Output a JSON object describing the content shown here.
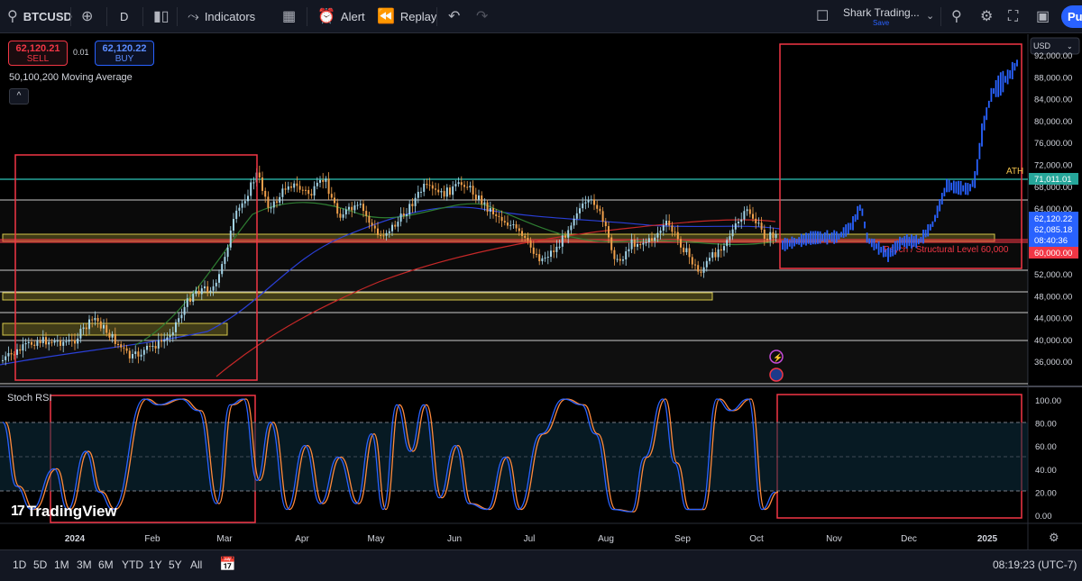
{
  "toolbar": {
    "symbol": "BTCUSD",
    "interval": "D",
    "indicators_label": "Indicators",
    "alert_label": "Alert",
    "replay_label": "Replay",
    "layout_name": "Shark Trading...",
    "save_label": "Save",
    "publish_label": "Pu",
    "icons": [
      "search-icon",
      "add-symbol-icon",
      "candles-icon",
      "indicators-icon",
      "templates-icon",
      "alert-icon",
      "replay-icon",
      "undo-icon",
      "redo-icon",
      "layout-icon",
      "chevron-down-icon",
      "quick-search-icon",
      "settings-icon",
      "fullscreen-icon",
      "camera-icon"
    ]
  },
  "trade": {
    "sell_price": "62,120.21",
    "sell_label": "SELL",
    "spread": "0.01",
    "buy_price": "62,120.22",
    "buy_label": "BUY"
  },
  "legend": {
    "moving_average": "50,100,200 Moving Average",
    "collapse_icon": "^"
  },
  "price_axis": {
    "currency": "USD",
    "ticks": [
      "92,000.00",
      "88,000.00",
      "84,000.00",
      "80,000.00",
      "76,000.00",
      "72,000.00",
      "68,000.00",
      "64,000.00",
      "60,000.00",
      "56,000.00",
      "52,000.00",
      "48,000.00",
      "44,000.00",
      "40,000.00",
      "36,000.00"
    ],
    "labels": {
      "level_71011": "71,011.01",
      "last_price": "62,120.22",
      "bid": "62,085.18",
      "countdown": "08:40:36",
      "level_60000": "60,000.00",
      "ath": "ATH"
    }
  },
  "annotation": {
    "structural_level": "Psych / Structural Level 60,000"
  },
  "stoch": {
    "title": "Stoch RSI",
    "ticks": [
      "100.00",
      "80.00",
      "60.00",
      "40.00",
      "20.00",
      "0.00"
    ]
  },
  "time_axis": {
    "labels": [
      "2024",
      "Feb",
      "Mar",
      "Apr",
      "May",
      "Jun",
      "Jul",
      "Aug",
      "Sep",
      "Oct",
      "Nov",
      "Dec",
      "2025"
    ]
  },
  "bottombar": {
    "ranges": [
      "1D",
      "5D",
      "1M",
      "3M",
      "6M",
      "YTD",
      "1Y",
      "5Y",
      "All"
    ],
    "clock": "08:19:23 (UTC-7)"
  },
  "brand": {
    "name": "TradingView",
    "mark": "17"
  },
  "colors": {
    "background": "#000000",
    "up": "#a3d4e8",
    "down": "#f0a04b",
    "projection": "#2962ff",
    "box_red": "#f23645",
    "zone_yellow": "#d4c64a",
    "teal_line": "#26a69a",
    "ma_blue": "#2a3fd6",
    "ma_red": "#c62828",
    "ma_green": "#2e7d32",
    "stoch_k": "#2962ff",
    "stoch_d": "#ff8a3d"
  }
}
